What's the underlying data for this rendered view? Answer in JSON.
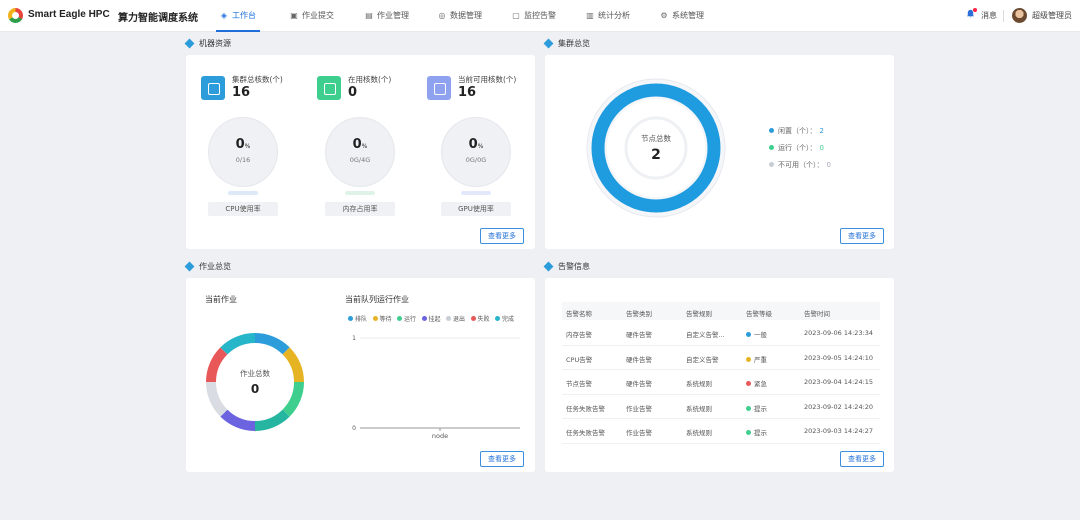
{
  "header": {
    "brand": "Smart Eagle HPC",
    "system_name": "算力智能调度系统",
    "nav": [
      {
        "label": "工作台",
        "icon": "workbench-icon",
        "active": true
      },
      {
        "label": "作业提交",
        "icon": "submit-icon",
        "active": false
      },
      {
        "label": "作业管理",
        "icon": "job-manage-icon",
        "active": false
      },
      {
        "label": "数据管理",
        "icon": "data-icon",
        "active": false
      },
      {
        "label": "监控告警",
        "icon": "monitor-icon",
        "active": false
      },
      {
        "label": "统计分析",
        "icon": "stats-icon",
        "active": false
      },
      {
        "label": "系统管理",
        "icon": "gear-icon",
        "active": false
      }
    ],
    "messages_label": "消息",
    "user_name": "超级管理员"
  },
  "machine": {
    "title": "机器资源",
    "stats": [
      {
        "label": "集群总核数(个)",
        "value": "16",
        "color": "#2d9cdb"
      },
      {
        "label": "在用核数(个)",
        "value": "0",
        "color": "#3ecf8e"
      },
      {
        "label": "当前可用核数(个)",
        "value": "16",
        "color": "#8ea2f0"
      }
    ],
    "gauges": [
      {
        "pct": "0",
        "unit": "%",
        "sub": "0/16",
        "label": "CPU使用率"
      },
      {
        "pct": "0",
        "unit": "%",
        "sub": "0G/4G",
        "label": "内存占用率"
      },
      {
        "pct": "0",
        "unit": "%",
        "sub": "0G/0G",
        "label": "GPU使用率"
      }
    ],
    "more": "查看更多"
  },
  "cluster": {
    "title": "集群总览",
    "center_label": "节点总数",
    "center_value": "2",
    "legend": [
      {
        "label": "闲置（个）：",
        "value": "2",
        "color": "#2d9cdb"
      },
      {
        "label": "运行（个）：",
        "value": "0",
        "color": "#3ecf8e"
      },
      {
        "label": "不可用（个）：",
        "value": "0",
        "color": "#c9cdd4"
      }
    ],
    "more": "查看更多"
  },
  "jobs": {
    "title": "作业总览",
    "current_label": "当前作业",
    "center_label": "作业总数",
    "center_value": "0",
    "queue_title": "当前队列运行作业",
    "more": "查看更多"
  },
  "chart_data": {
    "type": "bar",
    "title": "当前队列运行作业",
    "categories": [
      "node"
    ],
    "y_ticks": [
      "1",
      "0"
    ],
    "ylim": [
      0,
      1
    ],
    "legend_placement": "top",
    "series": [
      {
        "name": "排队",
        "values": [
          0
        ],
        "color": "#2d9cdb"
      },
      {
        "name": "等待",
        "values": [
          0
        ],
        "color": "#e6b422"
      },
      {
        "name": "运行",
        "values": [
          0
        ],
        "color": "#3ecf8e"
      },
      {
        "name": "挂起",
        "values": [
          0
        ],
        "color": "#6c63e0"
      },
      {
        "name": "退出",
        "values": [
          0
        ],
        "color": "#c9cdd4"
      },
      {
        "name": "失败",
        "values": [
          0
        ],
        "color": "#e85858"
      },
      {
        "name": "完成",
        "values": [
          0
        ],
        "color": "#26b5c9"
      }
    ]
  },
  "alarms": {
    "title": "告警信息",
    "columns": [
      "告警名称",
      "告警类别",
      "告警规则",
      "告警等级",
      "告警时间"
    ],
    "rows": [
      {
        "name": "内存告警",
        "category": "硬件告警",
        "rule": "自定义告警...",
        "level": "一般",
        "level_color": "#2d9cdb",
        "time": "2023-09-06 14:23:34"
      },
      {
        "name": "CPU告警",
        "category": "硬件告警",
        "rule": "自定义告警",
        "level": "严重",
        "level_color": "#e6b422",
        "time": "2023-09-05 14:24:10"
      },
      {
        "name": "节点告警",
        "category": "硬件告警",
        "rule": "系统规则",
        "level": "紧急",
        "level_color": "#e85858",
        "time": "2023-09-04 14:24:15"
      },
      {
        "name": "任务失败告警",
        "category": "作业告警",
        "rule": "系统规则",
        "level": "提示",
        "level_color": "#3ecf8e",
        "time": "2023-09-02 14:24:20"
      },
      {
        "name": "任务失败告警",
        "category": "作业告警",
        "rule": "系统规则",
        "level": "提示",
        "level_color": "#3ecf8e",
        "time": "2023-09-03 14:24:27"
      }
    ],
    "more": "查看更多"
  }
}
